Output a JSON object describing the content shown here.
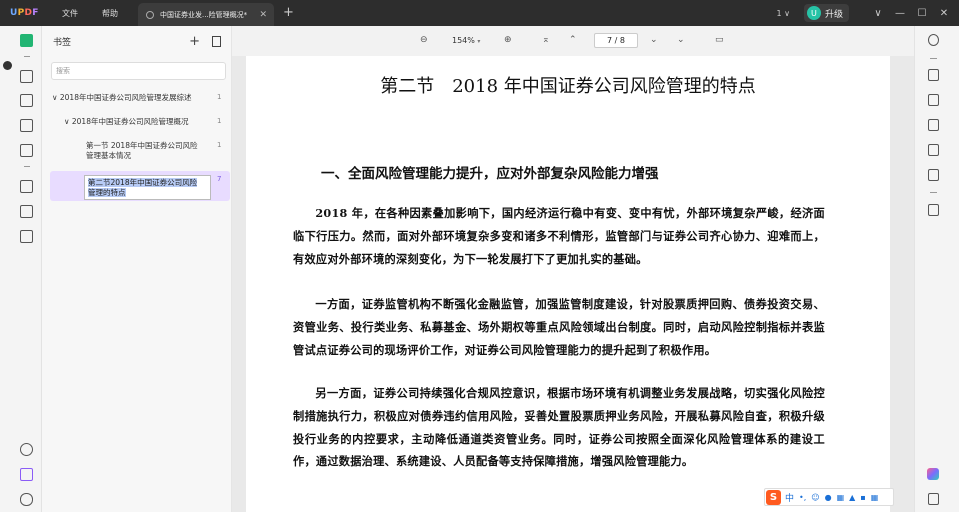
{
  "titlebar": {
    "logo": "UPDF",
    "menu": [
      "文件",
      "帮助"
    ],
    "tab_title": "中国证券业发...险管理概况*",
    "version_label": "1",
    "upgrade_label": "升级",
    "avatar_letter": "U"
  },
  "panel": {
    "title": "书签",
    "search_placeholder": "搜索",
    "bookmarks": [
      {
        "label": "2018年中国证券公司风险管理发展综述",
        "count": "1"
      },
      {
        "label": "2018年中国证券公司风险管理概况",
        "count": "1"
      },
      {
        "label_line1": "第一节 2018年中国证券公司风险",
        "label_line2": "管理基本情况",
        "count": "1"
      },
      {
        "label_line1": "第二节2018年中国证券公司风险",
        "label_line2": "管理的特点",
        "count": "7"
      }
    ]
  },
  "toolbar": {
    "zoom": "154%",
    "current_page": "7",
    "page_separator": "/",
    "total_pages": "8"
  },
  "document": {
    "title": "第二节　2018 年中国证券公司风险管理的特点",
    "heading": "一、全面风险管理能力提升，应对外部复杂风险能力增强",
    "paragraphs": [
      "2018 年，在各种因素叠加影响下，国内经济运行稳中有变、变中有忧，外部环境复杂严峻，经济面临下行压力。然而，面对外部环境复杂多变和诸多不利情形，监管部门与证券公司齐心协力、迎难而上，有效应对外部环境的深刻变化，为下一轮发展打下了更加扎实的基础。",
      "一方面，证券监管机构不断强化金融监管，加强监管制度建设，针对股票质押回购、债券投资交易、资管业务、投行类业务、私募基金、场外期权等重点风险领域出台制度。同时，启动风险控制指标并表监管试点证券公司的现场评价工作，对证券公司风险管理能力的提升起到了积极作用。",
      "另一方面，证券公司持续强化合规风控意识，根据市场环境有机调整业务发展战略，切实强化风险控制措施执行力，积极应对债券违约信用风险，妥善处置股票质押业务风险，开展私募风险自查，积极升级投行业务的内控要求，主动降低通道类资管业务。同时，证券公司按照全面深化风险管理体系的建设工作，通过数据治理、系统建设、人员配备等支持保障措施，增强风险管理能力。"
    ]
  },
  "ime": {
    "logo": "S",
    "lang": "中"
  }
}
